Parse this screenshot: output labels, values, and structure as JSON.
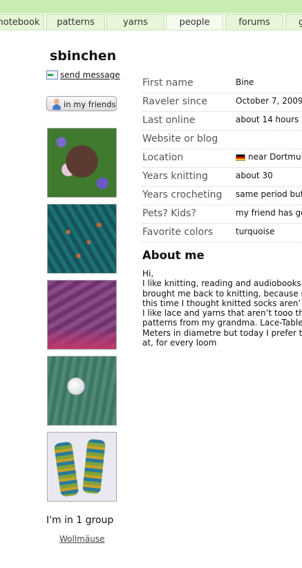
{
  "nav": {
    "tabs": [
      {
        "label": "notebook"
      },
      {
        "label": "patterns"
      },
      {
        "label": "yarns"
      },
      {
        "label": "people"
      },
      {
        "label": "forums"
      },
      {
        "label": "g"
      }
    ],
    "active": "people"
  },
  "profile": {
    "username": "sbinchen",
    "send_message": "send message",
    "friends_button": "in my friends"
  },
  "info": [
    {
      "label": "First name",
      "value": "Bine"
    },
    {
      "label": "Raveler since",
      "value": "October 7, 2009"
    },
    {
      "label": "Last online",
      "value": "about 14 hours"
    },
    {
      "label": "Website or blog",
      "value": ""
    },
    {
      "label": "Location",
      "value": "near Dortmu"
    },
    {
      "label": "Years knitting",
      "value": "about 30"
    },
    {
      "label": "Years crocheting",
      "value": "same period but"
    },
    {
      "label": "Pets? Kids?",
      "value": "my friend has go"
    },
    {
      "label": "Favorite colors",
      "value": "turquoise"
    }
  ],
  "about": {
    "heading": "About me",
    "lines": [
      "Hi,",
      "I like knitting, reading and audiobooks.",
      "brought me back to knitting, because s",
      "this time I thought knitted socks aren’",
      "I like lace and yarns that aren’t tooo th",
      "patterns from my grandma. Lace-Table",
      "Meters in diametre but today I prefer to",
      "at, for every loom"
    ]
  },
  "groups": {
    "title": "I'm in 1 group",
    "items": [
      "Wollmäuse"
    ]
  },
  "photos": [
    {
      "subject": "purple knitted hedgehog on flowers"
    },
    {
      "subject": "teal lace knitting"
    },
    {
      "subject": "purple and pink lace shawl"
    },
    {
      "subject": "green knitting with button"
    },
    {
      "subject": "striped hand-knit socks"
    }
  ],
  "colors": {
    "nav_green": "#c9ecb0",
    "tab_bg": "#e7f5d8"
  }
}
